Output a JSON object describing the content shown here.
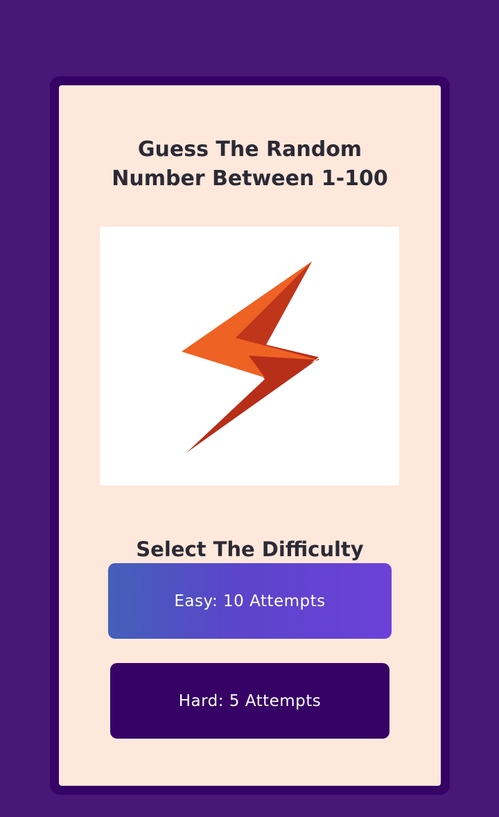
{
  "colors": {
    "page_background": "#491776",
    "card_frame": "#360265",
    "card_background": "#fee8dc",
    "text_dark": "#2b2a35",
    "easy_gradient": [
      "#4460b9",
      "#6c41d8"
    ],
    "hard_button": "#360265",
    "bolt_light": "#ee6224",
    "bolt_dark": "#b72e19"
  },
  "header": {
    "title_line1": "Guess The Random",
    "title_line2": "Number Between 1-100"
  },
  "hero": {
    "icon": "lightning-bolt-icon"
  },
  "difficulty": {
    "heading": "Select The Difficulty",
    "easy_label": "Easy: 10 Attempts",
    "hard_label": "Hard: 5 Attempts"
  }
}
